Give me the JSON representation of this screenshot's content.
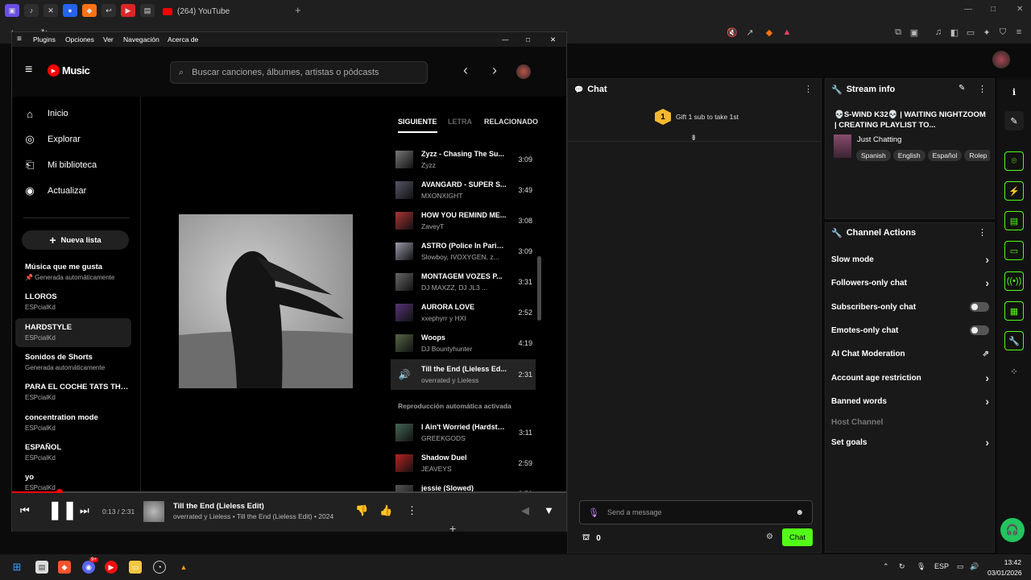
{
  "browser": {
    "active_tab": {
      "title": "(264) YouTube"
    },
    "new_tab": "+",
    "window_controls": {
      "minimize": "—",
      "maximize": "□",
      "close": "✕"
    }
  },
  "chat": {
    "title": "Chat",
    "gift_badge": "1",
    "gift_text": "Gift 1 sub to take 1st",
    "input_placeholder": "Send a message",
    "points": "0",
    "send_label": "Chat"
  },
  "stream_info": {
    "header": "Stream info",
    "title": "💀S-WIND K32💀 | WAITING NIGHTZOOM | CREATING PLAYLIST TO...",
    "category": "Just Chatting",
    "tags": [
      "Spanish",
      "English",
      "Español",
      "Rolep"
    ]
  },
  "channel_actions": {
    "header": "Channel Actions",
    "items": [
      {
        "label": "Slow mode",
        "control": "chevron"
      },
      {
        "label": "Followers-only chat",
        "control": "chevron"
      },
      {
        "label": "Subscribers-only chat",
        "control": "toggle"
      },
      {
        "label": "Emotes-only chat",
        "control": "toggle"
      },
      {
        "label": "AI Chat Moderation",
        "control": "external"
      },
      {
        "label": "Account age restriction",
        "control": "chevron"
      },
      {
        "label": "Banned words",
        "control": "chevron"
      },
      {
        "label": "Host Channel",
        "control": "none"
      },
      {
        "label": "Set goals",
        "control": "chevron"
      }
    ]
  },
  "ytm": {
    "menubar": [
      "Plugins",
      "Opciones",
      "Ver",
      "Navegación",
      "Acerca de"
    ],
    "logo": "Music",
    "search_placeholder": "Buscar canciones, álbumes, artistas o pódcasts",
    "nav": [
      {
        "label": "Inicio",
        "icon": "home-icon"
      },
      {
        "label": "Explorar",
        "icon": "explore-icon"
      },
      {
        "label": "Mi biblioteca",
        "icon": "library-icon"
      },
      {
        "label": "Actualizar",
        "icon": "upgrade-icon"
      }
    ],
    "new_playlist": "Nueva lista",
    "playlists": [
      {
        "title": "Música que me gusta",
        "sub": "📌 Generada automáticamente"
      },
      {
        "title": "LLOROS",
        "sub": "ESPcialKd"
      },
      {
        "title": "HARDSTYLE",
        "sub": "ESPcialKd"
      },
      {
        "title": "Sonidos de Shorts",
        "sub": "Generada automáticamente"
      },
      {
        "title": "PARA EL COCHE TATS THE ...",
        "sub": "ESPcialKd"
      },
      {
        "title": "concentration mode",
        "sub": "ESPcialKd"
      },
      {
        "title": "ESPAÑOL",
        "sub": "ESPcialKd"
      },
      {
        "title": "yo",
        "sub": "ESPcialKd"
      }
    ],
    "tabs": [
      "SIGUIENTE",
      "LETRA",
      "RELACIONADO"
    ],
    "queue": [
      {
        "title": "Zyzz - Chasing The Su...",
        "artist": "Zyzz",
        "duration": "3:09",
        "color": "#777"
      },
      {
        "title": "AVANGARD - SUPER S...",
        "artist": "MXONXIGHT",
        "duration": "3:49",
        "color": "#556"
      },
      {
        "title": "HOW YOU REMIND ME...",
        "artist": "ZaveyT",
        "duration": "3:08",
        "color": "#a33"
      },
      {
        "title": "ASTRO (Police In Paris...",
        "artist": "Slowboy, IVOXYGEN, z...",
        "duration": "3:09",
        "color": "#99a"
      },
      {
        "title": "MONTAGEM VOZES P...",
        "artist": "DJ MAXZZ, DJ JL3 ...",
        "duration": "3:31",
        "color": "#666"
      },
      {
        "title": "AURORA LOVE",
        "artist": "xxephyrr y HXI",
        "duration": "2:52",
        "color": "#537"
      },
      {
        "title": "Woops",
        "artist": "DJ Bountyhunter",
        "duration": "4:19",
        "color": "#564"
      },
      {
        "title": "Till the End (Lieless Ed...",
        "artist": "overrated y Lieless",
        "duration": "2:31",
        "color": "#242424",
        "playing": true
      }
    ],
    "autoplay_label": "Reproducción automática activada",
    "autoplay": [
      {
        "title": "I Ain't Worried (Hardstyle)",
        "artist": "GREEKGODS",
        "duration": "3:11",
        "color": "#465"
      },
      {
        "title": "Shadow Duel",
        "artist": "JEAVEYS",
        "duration": "2:59",
        "color": "#b22"
      },
      {
        "title": "jessie (Slowed)",
        "artist": "",
        "duration": "2:51",
        "color": "#555"
      }
    ],
    "player": {
      "time": "0:13 / 2:31",
      "title": "Till the End (Lieless Edit)",
      "subtitle": "overrated y Lieless • Till the End (Lieless Edit) • 2024",
      "progress": 0.086
    }
  },
  "taskbar": {
    "lang": "ESP",
    "time": "13:42",
    "date": "03/01/2026",
    "discord_badge": "9+"
  },
  "colors": {
    "kick_green": "#53fc18",
    "yt_red": "#ff0000"
  }
}
